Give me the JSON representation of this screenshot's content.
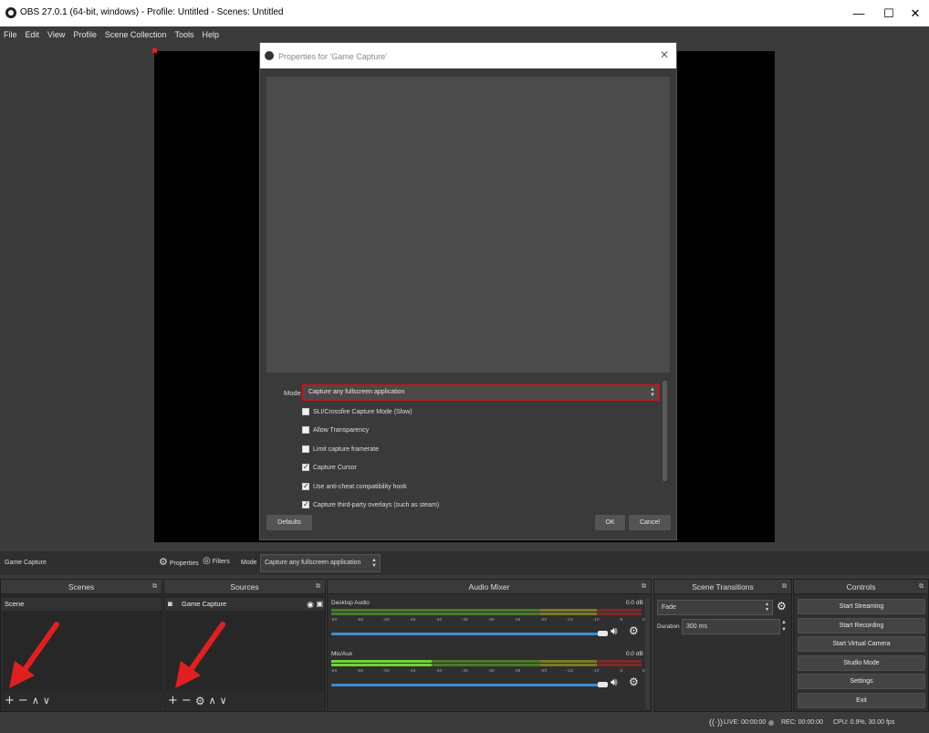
{
  "window": {
    "title": "OBS 27.0.1 (64-bit, windows) - Profile: Untitled - Scenes: Untitled",
    "minimize": "—",
    "maximize": "☐",
    "close": "✕"
  },
  "menu": [
    "File",
    "Edit",
    "View",
    "Profile",
    "Scene Collection",
    "Tools",
    "Help"
  ],
  "dialog": {
    "title": "Properties for 'Game Capture'",
    "close": "✕",
    "mode_label": "Mode",
    "mode_value": "Capture any fullscreen application",
    "checkboxes": [
      {
        "label": "SLI/Crossfire Capture Mode (Slow)",
        "checked": false
      },
      {
        "label": "Allow Transparency",
        "checked": false
      },
      {
        "label": "Limit capture framerate",
        "checked": false
      },
      {
        "label": "Capture Cursor",
        "checked": true
      },
      {
        "label": "Use anti-cheat compatibility hook",
        "checked": true
      },
      {
        "label": "Capture third-party overlays (such as steam)",
        "checked": true
      }
    ],
    "defaults_label": "Defaults",
    "ok_label": "OK",
    "cancel_label": "Cancel"
  },
  "source_toolbar": {
    "source_name": "Game Capture",
    "properties_label": "Properties",
    "filters_label": "Filters",
    "mode_label": "Mode",
    "mode_value": "Capture any fullscreen application"
  },
  "scenes": {
    "header": "Scenes",
    "items": [
      "Scene"
    ]
  },
  "sources": {
    "header": "Sources",
    "items": [
      "Game Capture"
    ]
  },
  "audio_mixer": {
    "header": "Audio Mixer",
    "channels": [
      {
        "name": "Desktop Audio",
        "db": "0.0 dB"
      },
      {
        "name": "Mic/Aux",
        "db": "0.0 dB"
      }
    ],
    "scale": [
      "-60",
      "-55",
      "-50",
      "-45",
      "-40",
      "-35",
      "-30",
      "-25",
      "-20",
      "-15",
      "-10",
      "-5",
      "0"
    ]
  },
  "transitions": {
    "header": "Scene Transitions",
    "transition": "Fade",
    "duration_label": "Duration",
    "duration_value": "300 ms"
  },
  "controls": {
    "header": "Controls",
    "buttons": [
      "Start Streaming",
      "Start Recording",
      "Start Virtual Camera",
      "Studio Mode",
      "Settings",
      "Exit"
    ]
  },
  "status": {
    "live": "LIVE: 00:00:00",
    "rec": "REC: 00:00:00",
    "cpu": "CPU: 0.9%, 30.00 fps"
  },
  "colors": {
    "highlight": "#c4151c",
    "annotation_arrow": "#e02020"
  }
}
